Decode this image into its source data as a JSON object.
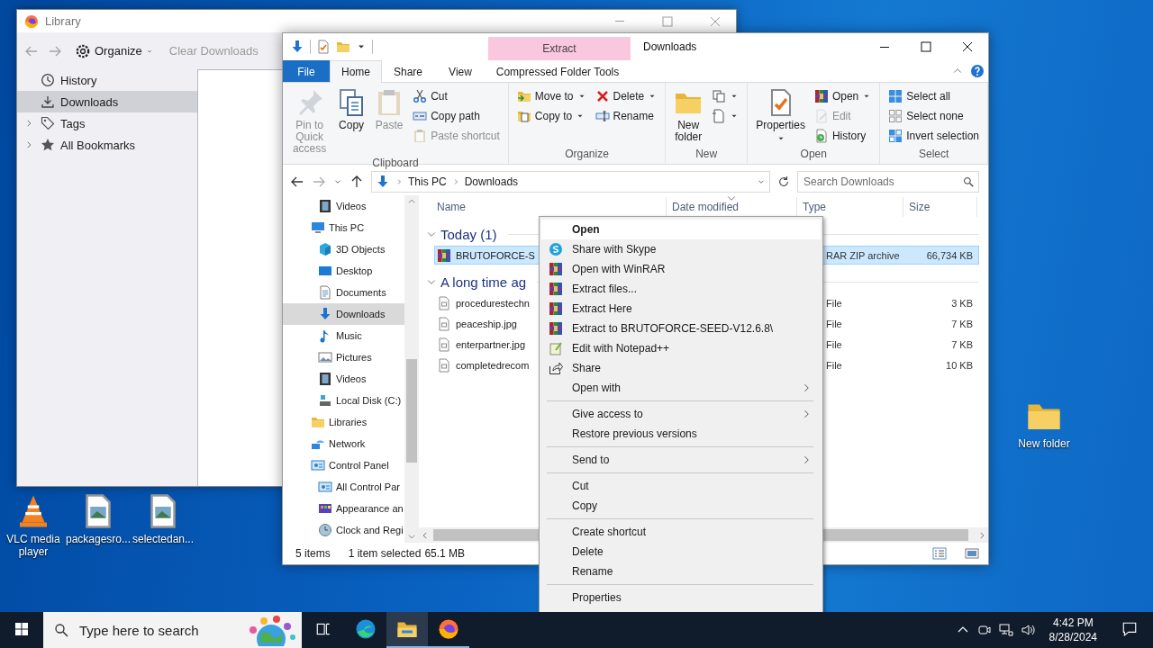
{
  "desktop": {
    "left_icons": [
      {
        "label": "VLC media player",
        "kind": "vlc"
      },
      {
        "label": "packagesro...",
        "kind": "image-file"
      },
      {
        "label": "selectedan...",
        "kind": "image-file"
      }
    ],
    "right_icons": [
      {
        "label": "New folder",
        "kind": "folder"
      }
    ]
  },
  "library": {
    "title": "Library",
    "organize": "Organize",
    "clear_downloads": "Clear Downloads",
    "clear_disabled": true,
    "sidebar": [
      {
        "label": "History",
        "kind": "clock",
        "selected": false,
        "expandable": false
      },
      {
        "label": "Downloads",
        "kind": "download",
        "selected": true,
        "expandable": false
      },
      {
        "label": "Tags",
        "kind": "tag",
        "selected": false,
        "expandable": true
      },
      {
        "label": "All Bookmarks",
        "kind": "star",
        "selected": false,
        "expandable": true
      }
    ]
  },
  "explorer": {
    "title": "Downloads",
    "context_tab": "Extract",
    "tabs": [
      {
        "label": "File",
        "kind": "file",
        "selected": false
      },
      {
        "label": "Home",
        "kind": "plain",
        "selected": true
      },
      {
        "label": "Share",
        "kind": "plain",
        "selected": false
      },
      {
        "label": "View",
        "kind": "plain",
        "selected": false
      },
      {
        "label": "Compressed Folder Tools",
        "kind": "context",
        "selected": false
      }
    ],
    "ribbon": [
      {
        "label": "Clipboard",
        "columns": [
          [
            {
              "label": "Pin to Quick access",
              "kind": "pin",
              "large": true,
              "disabled": true,
              "dropdown": false
            }
          ],
          [
            {
              "label": "Copy",
              "kind": "copy",
              "large": true,
              "disabled": false,
              "dropdown": false
            }
          ],
          [
            {
              "label": "Paste",
              "kind": "clipboard",
              "large": true,
              "disabled": true,
              "dropdown": false
            }
          ],
          [
            {
              "label": "Cut",
              "kind": "scissors",
              "large": false,
              "disabled": false,
              "dropdown": false
            },
            {
              "label": "Copy path",
              "kind": "path",
              "large": false,
              "disabled": false,
              "dropdown": false
            },
            {
              "label": "Paste shortcut",
              "kind": "clipboard",
              "large": false,
              "disabled": true,
              "dropdown": false
            }
          ]
        ]
      },
      {
        "label": "Organize",
        "columns": [
          [
            {
              "label": "Move to",
              "kind": "folder-move",
              "large": false,
              "disabled": false,
              "dropdown": true
            },
            {
              "label": "Copy to",
              "kind": "folder-copy",
              "large": false,
              "disabled": false,
              "dropdown": true
            }
          ],
          [
            {
              "label": "Delete",
              "kind": "delete",
              "large": false,
              "disabled": false,
              "dropdown": true
            },
            {
              "label": "Rename",
              "kind": "rename",
              "large": false,
              "disabled": false,
              "dropdown": false
            }
          ]
        ]
      },
      {
        "label": "New",
        "columns": [
          [
            {
              "label": "New folder",
              "kind": "folder",
              "large": true,
              "disabled": false,
              "dropdown": false
            }
          ],
          [
            {
              "kind": "pages",
              "large": false,
              "disabled": false,
              "dropdown": true
            },
            {
              "kind": "page",
              "large": false,
              "disabled": false,
              "dropdown": true
            }
          ]
        ]
      },
      {
        "label": "Open",
        "columns": [
          [
            {
              "label": "Properties",
              "kind": "checklist",
              "large": true,
              "disabled": false,
              "dropdown": true
            }
          ],
          [
            {
              "label": "Open",
              "kind": "books",
              "large": false,
              "disabled": false,
              "dropdown": true
            },
            {
              "label": "Edit",
              "kind": "edit",
              "large": false,
              "disabled": true,
              "dropdown": false
            },
            {
              "label": "History",
              "kind": "history",
              "large": false,
              "disabled": false,
              "dropdown": false
            }
          ]
        ]
      },
      {
        "label": "Select",
        "columns": [
          [
            {
              "label": "Select all",
              "kind": "grid-all",
              "large": false,
              "disabled": false,
              "dropdown": false
            },
            {
              "label": "Select none",
              "kind": "grid-none",
              "large": false,
              "disabled": false,
              "dropdown": false
            },
            {
              "label": "Invert selection",
              "kind": "grid-invert",
              "large": false,
              "disabled": false,
              "dropdown": false
            }
          ]
        ]
      }
    ],
    "crumbs": [
      "This PC",
      "Downloads"
    ],
    "search_placeholder": "Search Downloads",
    "nav_top": [
      {
        "label": "Videos",
        "kind": "film",
        "selected": false
      }
    ],
    "nav_tree": [
      {
        "label": "This PC",
        "kind": "monitor",
        "selected": false,
        "children": [
          {
            "label": "3D Objects",
            "kind": "cube",
            "selected": false
          },
          {
            "label": "Desktop",
            "kind": "desktop",
            "selected": false
          },
          {
            "label": "Documents",
            "kind": "document",
            "selected": false
          },
          {
            "label": "Downloads",
            "kind": "arrow-down",
            "selected": true
          },
          {
            "label": "Music",
            "kind": "music",
            "selected": false
          },
          {
            "label": "Pictures",
            "kind": "picture",
            "selected": false
          },
          {
            "label": "Videos",
            "kind": "film",
            "selected": false
          },
          {
            "label": "Local Disk (C:)",
            "kind": "drive",
            "selected": false
          }
        ]
      },
      {
        "label": "Libraries",
        "kind": "folder",
        "selected": false
      },
      {
        "label": "Network",
        "kind": "network",
        "selected": false
      },
      {
        "label": "Control Panel",
        "kind": "panel",
        "selected": false,
        "children": [
          {
            "label": "All Control Par",
            "kind": "panel",
            "selected": false
          },
          {
            "label": "Appearance an",
            "kind": "palette",
            "selected": false
          },
          {
            "label": "Clock and Regi",
            "kind": "globe",
            "selected": false
          }
        ]
      }
    ],
    "columns": [
      {
        "label": "Name",
        "sorted": false
      },
      {
        "label": "Date modified",
        "sorted": true
      },
      {
        "label": "Type",
        "sorted": false
      },
      {
        "label": "Size",
        "sorted": false
      }
    ],
    "groups": [
      {
        "label": "Today (1)",
        "expanded": true,
        "files": [
          {
            "name": "BRUTOFORCE-S",
            "kind": "books",
            "type": "RAR ZIP archive",
            "size": "66,734 KB",
            "selected": true
          }
        ]
      },
      {
        "label": "A long time ag",
        "expanded": true,
        "files": [
          {
            "name": "procedurestechn",
            "kind": "file",
            "type": "File",
            "size": "3 KB",
            "selected": false
          },
          {
            "name": "peaceship.jpg",
            "kind": "file",
            "type": "File",
            "size": "7 KB",
            "selected": false
          },
          {
            "name": "enterpartner.jpg",
            "kind": "file",
            "type": "File",
            "size": "7 KB",
            "selected": false
          },
          {
            "name": "completedrecom",
            "kind": "file",
            "type": "File",
            "size": "10 KB",
            "selected": false
          }
        ]
      }
    ],
    "status": {
      "count": "5 items",
      "selection": "1 item selected",
      "size": "65.1 MB"
    }
  },
  "context_menu": {
    "groups": [
      [
        {
          "label": "Open",
          "kind": "none",
          "bold": true,
          "highlighted": true,
          "submenu": false
        },
        {
          "label": "Share with Skype",
          "kind": "skype",
          "bold": false,
          "highlighted": false,
          "submenu": false
        },
        {
          "label": "Open with WinRAR",
          "kind": "books",
          "bold": false,
          "highlighted": false,
          "submenu": false
        },
        {
          "label": "Extract files...",
          "kind": "books",
          "bold": false,
          "highlighted": false,
          "submenu": false
        },
        {
          "label": "Extract Here",
          "kind": "books",
          "bold": false,
          "highlighted": false,
          "submenu": false
        },
        {
          "label": "Extract to BRUTOFORCE-SEED-V12.6.8\\",
          "kind": "books",
          "bold": false,
          "highlighted": false,
          "submenu": false
        },
        {
          "label": "Edit with Notepad++",
          "kind": "notepad",
          "bold": false,
          "highlighted": false,
          "submenu": false
        },
        {
          "label": "Share",
          "kind": "share",
          "bold": false,
          "highlighted": false,
          "submenu": false
        },
        {
          "label": "Open with",
          "kind": "none",
          "bold": false,
          "highlighted": false,
          "submenu": true
        }
      ],
      [
        {
          "label": "Give access to",
          "kind": "none",
          "bold": false,
          "highlighted": false,
          "submenu": true
        },
        {
          "label": "Restore previous versions",
          "kind": "none",
          "bold": false,
          "highlighted": false,
          "submenu": false
        }
      ],
      [
        {
          "label": "Send to",
          "kind": "none",
          "bold": false,
          "highlighted": false,
          "submenu": true
        }
      ],
      [
        {
          "label": "Cut",
          "kind": "none",
          "bold": false,
          "highlighted": false,
          "submenu": false
        },
        {
          "label": "Copy",
          "kind": "none",
          "bold": false,
          "highlighted": false,
          "submenu": false
        }
      ],
      [
        {
          "label": "Create shortcut",
          "kind": "none",
          "bold": false,
          "highlighted": false,
          "submenu": false
        },
        {
          "label": "Delete",
          "kind": "none",
          "bold": false,
          "highlighted": false,
          "submenu": false
        },
        {
          "label": "Rename",
          "kind": "none",
          "bold": false,
          "highlighted": false,
          "submenu": false
        }
      ],
      [
        {
          "label": "Properties",
          "kind": "none",
          "bold": false,
          "highlighted": false,
          "submenu": false
        }
      ]
    ]
  },
  "taskbar": {
    "search_placeholder": "Type here to search",
    "apps": [
      {
        "kind": "edge",
        "active": false,
        "running": false
      },
      {
        "kind": "explorer",
        "active": true,
        "running": true
      },
      {
        "kind": "firefox",
        "active": false,
        "running": true
      }
    ],
    "time": "4:42 PM",
    "date": "8/28/2024"
  }
}
